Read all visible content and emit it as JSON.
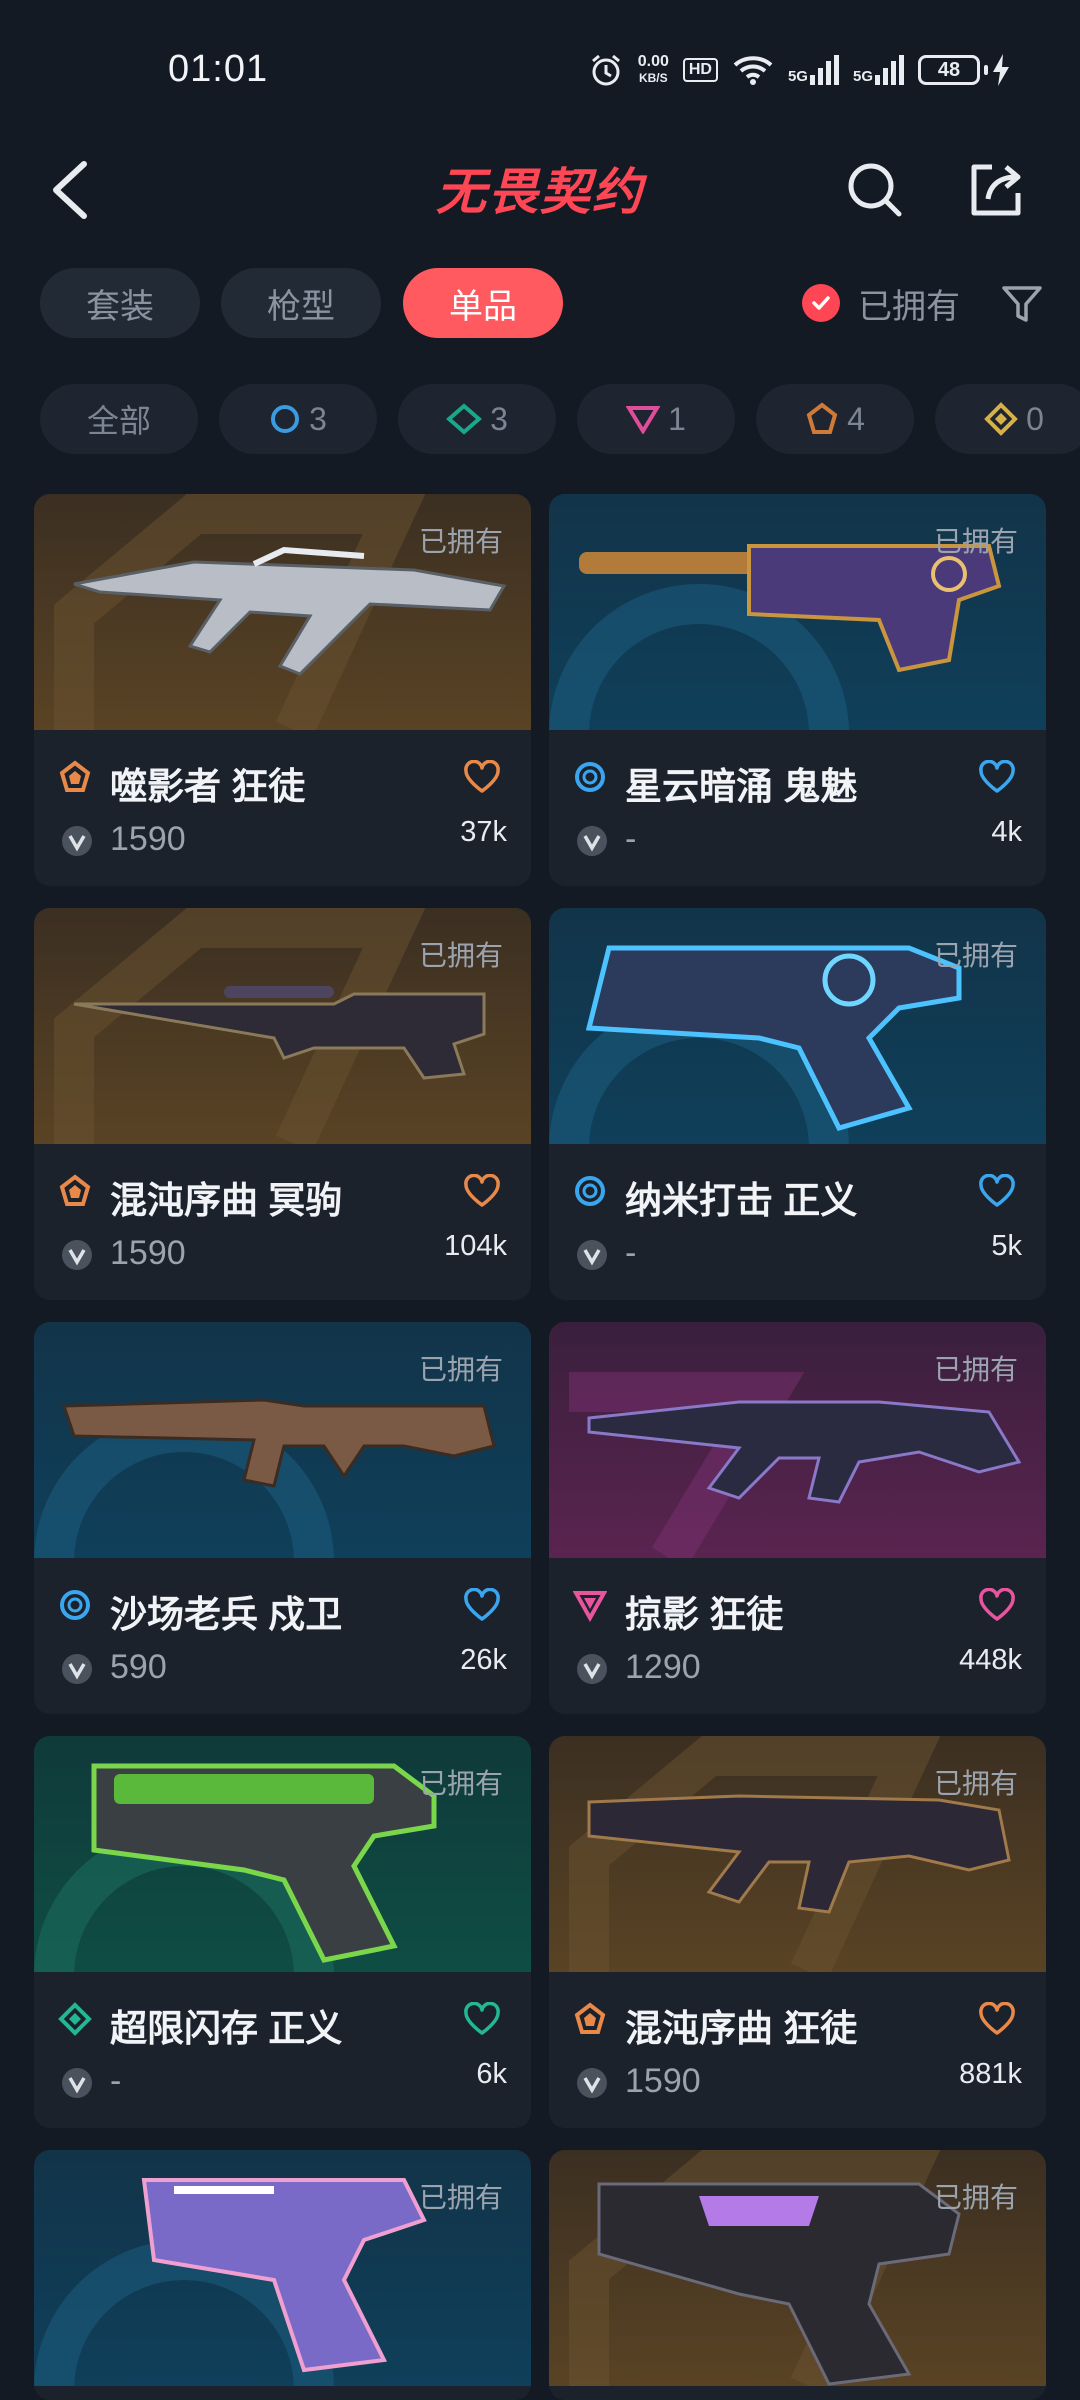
{
  "status_bar": {
    "time": "01:01",
    "net_speed_value": "0.00",
    "net_speed_unit": "KB/S",
    "hd": "HD",
    "signal1": "5G",
    "signal2": "5G",
    "battery": "48"
  },
  "header": {
    "title": "无畏契约"
  },
  "tabs": [
    {
      "label": "套装",
      "active": false
    },
    {
      "label": "枪型",
      "active": false
    },
    {
      "label": "单品",
      "active": true
    }
  ],
  "owned_filter": {
    "label": "已拥有",
    "checked": true
  },
  "tier_chips": [
    {
      "label": "全部",
      "count": ""
    },
    {
      "icon": "select-tier-icon",
      "color": "#3a9be0",
      "count": "3"
    },
    {
      "icon": "deluxe-tier-icon",
      "color": "#1aa88a",
      "count": "3"
    },
    {
      "icon": "exclusive-tier-icon",
      "color": "#e04d9a",
      "count": "1"
    },
    {
      "icon": "premium-tier-icon",
      "color": "#d07a3a",
      "count": "4"
    },
    {
      "icon": "ultra-tier-icon",
      "color": "#d7b04a",
      "count": "0"
    }
  ],
  "cards": [
    {
      "name": "噬影者 狂徒",
      "price": "1590",
      "likes": "37k",
      "owned": "已拥有",
      "tier": "premium",
      "tier_color": "#e8894a",
      "bg": "gold"
    },
    {
      "name": "星云暗涌 鬼魅",
      "price": "-",
      "likes": "4k",
      "owned": "已拥有",
      "tier": "select",
      "tier_color": "#3aa6f0",
      "bg": "blue"
    },
    {
      "name": "混沌序曲 冥驹",
      "price": "1590",
      "likes": "104k",
      "owned": "已拥有",
      "tier": "premium",
      "tier_color": "#e8894a",
      "bg": "gold"
    },
    {
      "name": "纳米打击 正义",
      "price": "-",
      "likes": "5k",
      "owned": "已拥有",
      "tier": "select",
      "tier_color": "#3aa6f0",
      "bg": "blue"
    },
    {
      "name": "沙场老兵 戍卫",
      "price": "590",
      "likes": "26k",
      "owned": "已拥有",
      "tier": "select",
      "tier_color": "#3aa6f0",
      "bg": "blue"
    },
    {
      "name": "掠影 狂徒",
      "price": "1290",
      "likes": "448k",
      "owned": "已拥有",
      "tier": "exclusive",
      "tier_color": "#e8559e",
      "bg": "pink"
    },
    {
      "name": "超限闪存 正义",
      "price": "-",
      "likes": "6k",
      "owned": "已拥有",
      "tier": "deluxe",
      "tier_color": "#22b894",
      "bg": "green"
    },
    {
      "name": "混沌序曲 狂徒",
      "price": "1590",
      "likes": "881k",
      "owned": "已拥有",
      "tier": "premium",
      "tier_color": "#e8894a",
      "bg": "gold"
    },
    {
      "name": "",
      "price": "",
      "likes": "",
      "owned": "已拥有",
      "tier": "",
      "tier_color": "",
      "bg": "blue"
    },
    {
      "name": "",
      "price": "",
      "likes": "",
      "owned": "已拥有",
      "tier": "",
      "tier_color": "",
      "bg": "gold"
    }
  ]
}
